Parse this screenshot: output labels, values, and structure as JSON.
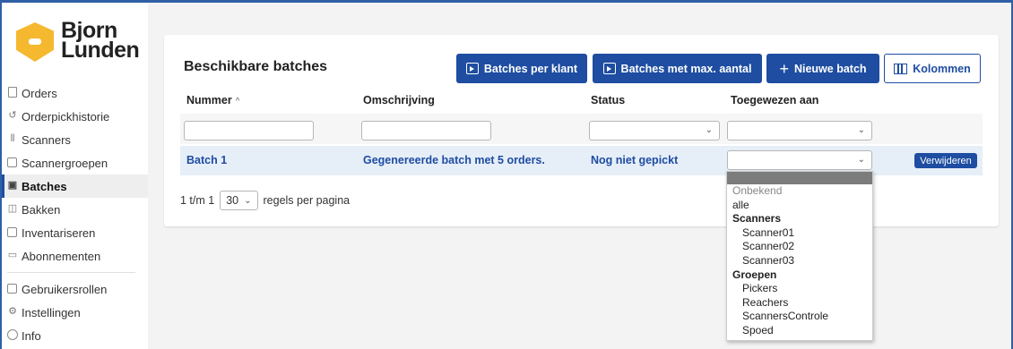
{
  "brand": {
    "name_line1": "Bjorn",
    "name_line2": "Lunden",
    "badge_color": "#f5b82e"
  },
  "sidebar": {
    "items": [
      {
        "label": "Orders",
        "icon": "document-icon"
      },
      {
        "label": "Orderpickhistorie",
        "icon": "history-icon"
      },
      {
        "label": "Scanners",
        "icon": "barcode-icon"
      },
      {
        "label": "Scannergroepen",
        "icon": "scanner-group-icon"
      },
      {
        "label": "Batches",
        "icon": "batches-icon",
        "active": true
      },
      {
        "label": "Bakken",
        "icon": "bin-icon"
      },
      {
        "label": "Inventariseren",
        "icon": "clipboard-icon"
      },
      {
        "label": "Abonnementen",
        "icon": "monitor-icon"
      }
    ],
    "footer_items": [
      {
        "label": "Gebruikersrollen",
        "icon": "user-roles-icon"
      },
      {
        "label": "Instellingen",
        "icon": "gear-icon"
      },
      {
        "label": "Info",
        "icon": "info-icon"
      }
    ]
  },
  "card": {
    "title": "Beschikbare batches",
    "buttons": {
      "batches_per_klant": "Batches per klant",
      "batches_max_aantal": "Batches met max. aantal",
      "nieuwe_batch": "Nieuwe batch",
      "kolommen": "Kolommen"
    },
    "columns": [
      "Nummer",
      "Omschrijving",
      "Status",
      "Toegewezen aan"
    ],
    "sort_indicator": "^",
    "rows": [
      {
        "nummer": "Batch 1",
        "omschrijving": "Gegenereerde batch met 5 orders.",
        "status": "Nog niet gepickt",
        "toegewezen_aan": "",
        "action": "Verwijderen"
      }
    ],
    "pager": {
      "range": "1 t/m 1",
      "per_page": "30",
      "per_page_label": "regels per pagina"
    }
  },
  "dropdown": {
    "options": [
      "Onbekend",
      "alle"
    ],
    "groups": [
      {
        "label": "Scanners",
        "items": [
          "Scanner01",
          "Scanner02",
          "Scanner03"
        ]
      },
      {
        "label": "Groepen",
        "items": [
          "Pickers",
          "Reachers",
          "ScannersControle",
          "Spoed"
        ]
      }
    ]
  },
  "colors": {
    "accent": "#1e4da1",
    "row_highlight": "#e6eef8",
    "dropdown_highlight": "#7c7c7c"
  }
}
